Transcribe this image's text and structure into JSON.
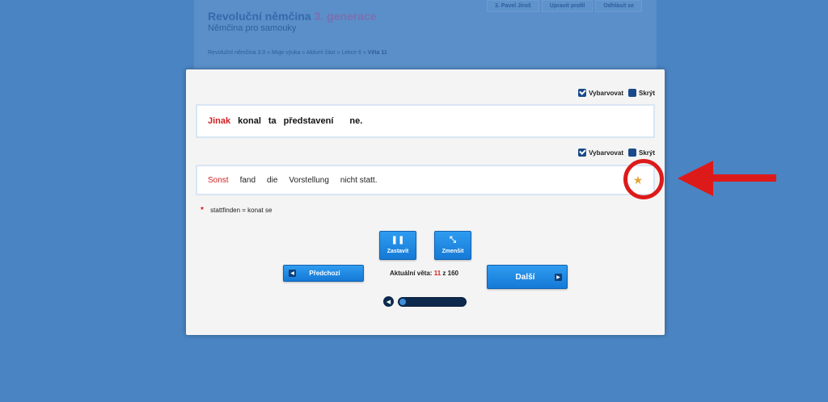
{
  "background_page": {
    "title_main": "Revoluční němčina",
    "title_generation": "3. generace",
    "subtitle": "Němčina pro samouky",
    "breadcrumb": "Revoluční němčina 3.0 » Moje výuka » Aktivní část » Lekce 6 » ",
    "breadcrumb_current": "Věta 11",
    "topnav": [
      "3. Pavel Jiroš",
      "Upravit profil",
      "Odhlásit se"
    ]
  },
  "czech_toggles": {
    "colorize_label": "Vybarvovat",
    "hide_label": "Skrýt"
  },
  "czech_sentence": [
    {
      "text": "Jinak",
      "highlight": true
    },
    {
      "text": "konal",
      "highlight": false
    },
    {
      "text": "ta",
      "highlight": false
    },
    {
      "text": "představení",
      "highlight": false
    },
    {
      "text": "ne.",
      "highlight": false
    }
  ],
  "german_toggles": {
    "colorize_label": "Vybarvovat",
    "hide_label": "Skrýt"
  },
  "german_sentence": [
    {
      "text": "Sonst",
      "highlight": true
    },
    {
      "text": "fand",
      "highlight": false
    },
    {
      "text": "die",
      "highlight": false
    },
    {
      "text": "Vorstellung",
      "highlight": false
    },
    {
      "text": "nicht statt.",
      "highlight": false
    }
  ],
  "star_icon": "★",
  "note": {
    "marker": "*",
    "text": "stattfinden = konat se"
  },
  "controls": {
    "pause_icon": "❚❚",
    "pause_label": "Zastavit",
    "shrink_icon": "⤡",
    "shrink_label": "Zmenšit",
    "prev_icon": "◀",
    "prev_label": "Předchozí",
    "next_label": "Další",
    "next_icon": "▶",
    "counter_prefix": "Aktuální věta:",
    "counter_current": "11",
    "counter_sep": "z",
    "counter_total": "160"
  },
  "audio": {
    "volume_icon": "🔊",
    "progress_fraction": 0.1
  },
  "colors": {
    "highlight": "#d21e1e",
    "button": "#1a86e2",
    "annotation": "#dd1a1a"
  }
}
